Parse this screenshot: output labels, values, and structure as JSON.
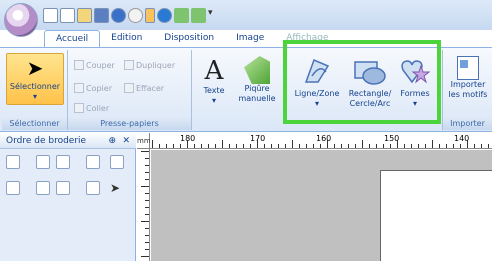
{
  "tabs": [
    "Accueil",
    "Edition",
    "Disposition",
    "Image",
    "Affichage"
  ],
  "ribbon": {
    "select_label": "Sélectionner",
    "select_group": "Sélectionner",
    "cut": "Couper",
    "duplicate": "Dupliquer",
    "copy": "Copier",
    "erase": "Effacer",
    "paste": "Coller",
    "clipboard_group": "Presse-papiers",
    "text_label": "Texte",
    "manual_stitch_line1": "Piqûre",
    "manual_stitch_line2": "manuelle",
    "line_zone": "Ligne/Zone",
    "rect_line1": "Rectangle/",
    "rect_line2": "Cercle/Arc",
    "shapes": "Formes",
    "import_line1": "Importer",
    "import_line2": "les motifs",
    "import_group": "Importer"
  },
  "panel": {
    "title": "Ordre de broderie",
    "pin": "⊕",
    "close": "✕"
  },
  "ruler": {
    "unit": "mm",
    "labels": [
      "180",
      "170",
      "160",
      "150",
      "140"
    ]
  },
  "colors": {
    "highlight": "#4cd43c",
    "ribbon_text": "#15428b"
  }
}
